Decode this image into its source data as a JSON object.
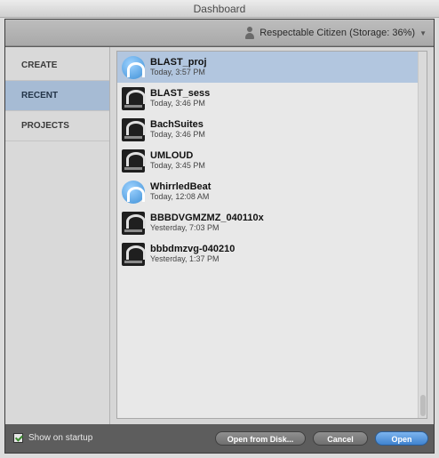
{
  "window": {
    "title": "Dashboard"
  },
  "userbar": {
    "user_label": "Respectable Citizen (Storage: 36%)"
  },
  "sidebar": {
    "items": [
      {
        "label": "CREATE",
        "active": false
      },
      {
        "label": "RECENT",
        "active": true
      },
      {
        "label": "PROJECTS",
        "active": false
      }
    ]
  },
  "recent": {
    "items": [
      {
        "name": "BLAST_proj",
        "date": "Today, 3:57 PM",
        "kind": "project",
        "selected": true
      },
      {
        "name": "BLAST_sess",
        "date": "Today, 3:46 PM",
        "kind": "session",
        "selected": false
      },
      {
        "name": "BachSuites",
        "date": "Today, 3:46 PM",
        "kind": "session",
        "selected": false
      },
      {
        "name": "UMLOUD",
        "date": "Today, 3:45 PM",
        "kind": "session",
        "selected": false
      },
      {
        "name": "WhirrledBeat",
        "date": "Today, 12:08 AM",
        "kind": "project",
        "selected": false
      },
      {
        "name": "BBBDVGMZMZ_040110x",
        "date": "Yesterday, 7:03 PM",
        "kind": "session",
        "selected": false
      },
      {
        "name": "bbbdmzvg-040210",
        "date": "Yesterday, 1:37 PM",
        "kind": "session",
        "selected": false
      }
    ]
  },
  "footer": {
    "show_on_startup_label": "Show on startup",
    "show_on_startup_checked": true,
    "open_from_disk_label": "Open from Disk...",
    "cancel_label": "Cancel",
    "open_label": "Open"
  },
  "icons": {
    "user": "person-icon",
    "dropdown": "chevron-down-icon",
    "project": "project-icon",
    "session": "session-icon"
  }
}
